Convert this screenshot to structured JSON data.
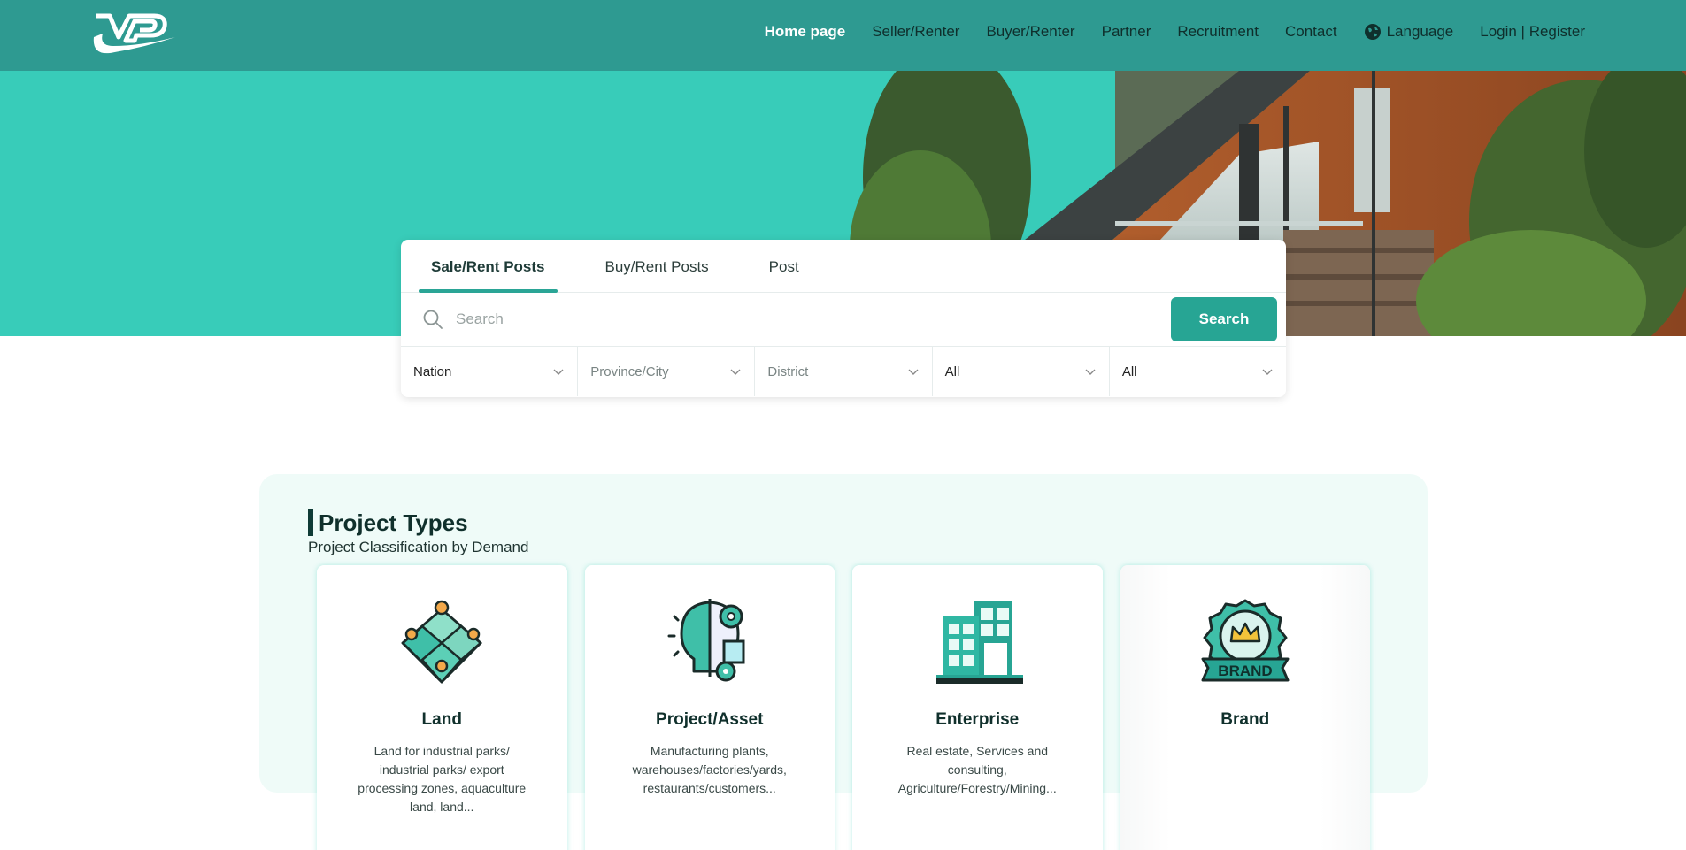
{
  "nav": {
    "items": [
      {
        "label": "Home page",
        "active": true
      },
      {
        "label": "Seller/Renter"
      },
      {
        "label": "Buyer/Renter"
      },
      {
        "label": "Partner"
      },
      {
        "label": "Recruitment"
      },
      {
        "label": "Contact"
      }
    ],
    "language_label": "Language",
    "auth_label": "Login | Register"
  },
  "search_panel": {
    "tabs": [
      {
        "label": "Sale/Rent Posts",
        "active": true
      },
      {
        "label": "Buy/Rent Posts"
      },
      {
        "label": "Post"
      }
    ],
    "search_placeholder": "Search",
    "search_button": "Search",
    "filters": [
      {
        "value": "Nation"
      },
      {
        "value": "Province/City"
      },
      {
        "value": "District"
      },
      {
        "value": "All"
      },
      {
        "value": "All"
      }
    ]
  },
  "project_types": {
    "title": "Project Types",
    "subtitle": "Project Classification by Demand",
    "cards": [
      {
        "title": "Land",
        "description": "Land for industrial parks/ industrial parks/ export processing zones, aquaculture land, land..."
      },
      {
        "title": "Project/Asset",
        "description": "Manufacturing plants, warehouses/factories/yards, restaurants/customers..."
      },
      {
        "title": "Enterprise",
        "description": "Real estate, Services and consulting, Agriculture/Forestry/Mining..."
      },
      {
        "title": "Brand",
        "description": ""
      }
    ],
    "brand_badge_text": "BRAND"
  },
  "colors": {
    "nav_bg": "#2e9a91",
    "hero_bg": "#38ccb9",
    "accent": "#27a594"
  }
}
